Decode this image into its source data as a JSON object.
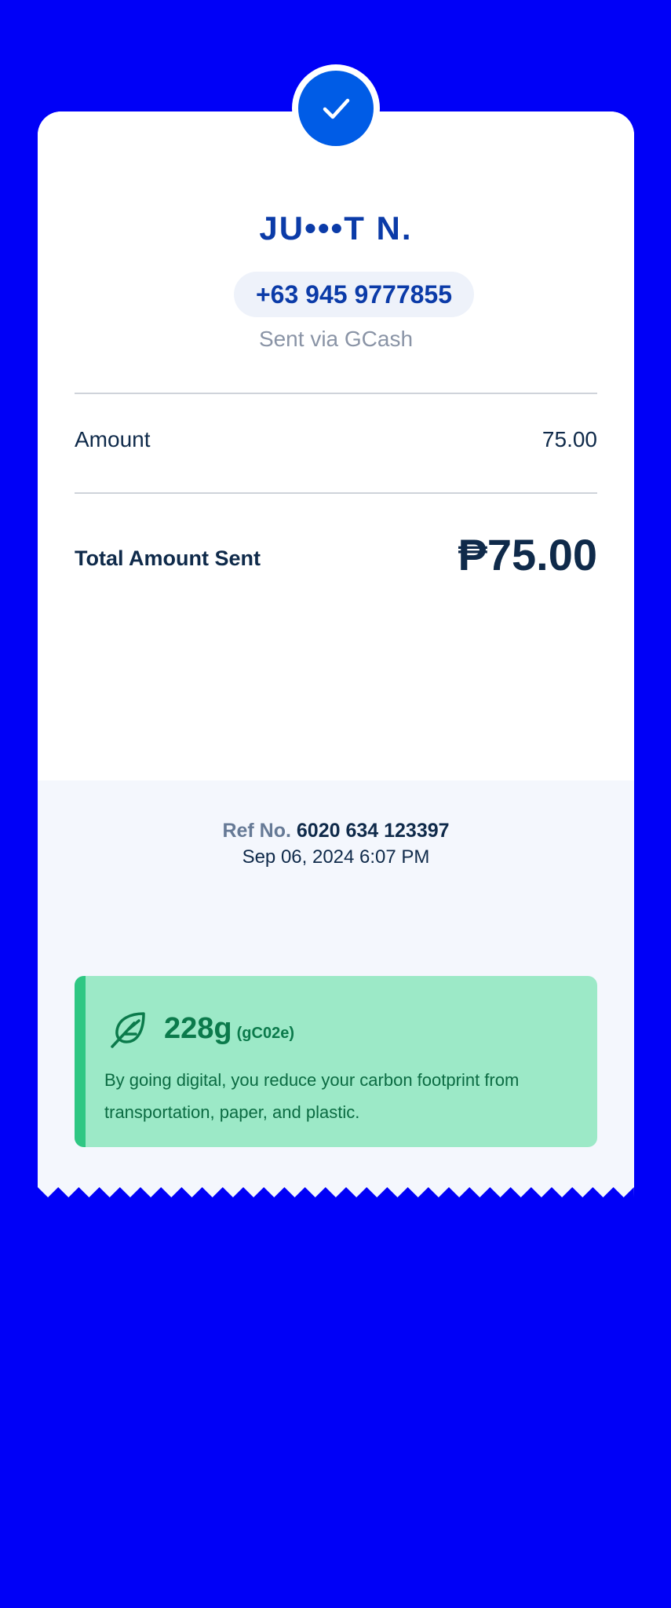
{
  "recipient": {
    "name": "JU•••T N.",
    "phone": "+63 945 9777855",
    "sent_via": "Sent via GCash"
  },
  "details": {
    "amount_label": "Amount",
    "amount_value": "75.00",
    "total_label": "Total Amount Sent",
    "total_value": "₱75.00"
  },
  "reference": {
    "label": "Ref No.",
    "number": "6020 634 123397",
    "datetime": "Sep 06, 2024 6:07 PM"
  },
  "carbon": {
    "value": "228g",
    "unit": "(gC02e)",
    "message": "By going digital, you reduce your carbon footprint from transportation, paper, and plastic.",
    "icon": "leaf-icon"
  },
  "icons": {
    "success": "check-icon"
  },
  "colors": {
    "background": "#0000F7",
    "brand_blue": "#005CE6",
    "name_blue": "#0B3BA8",
    "text_dark": "#0F2A4A",
    "carbon_bg": "#9CE9C7",
    "carbon_accent": "#2EC783",
    "carbon_text": "#0B7A4B"
  }
}
